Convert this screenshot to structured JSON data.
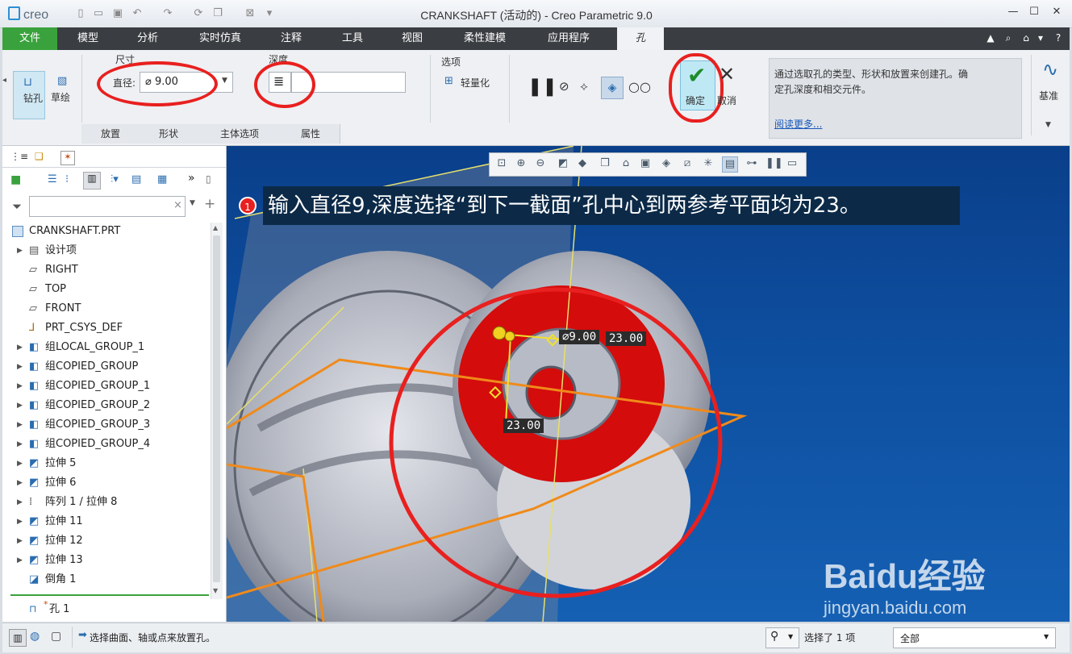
{
  "app": {
    "logo": "creo",
    "window_title": "CRANKSHAFT (活动的) - Creo Parametric 9.0"
  },
  "menu_tabs": [
    "文件",
    "模型",
    "分析",
    "实时仿真",
    "注释",
    "工具",
    "视图",
    "柔性建模",
    "应用程序",
    "孔"
  ],
  "ribbon": {
    "type_buttons": {
      "drill": "钻孔",
      "sketch": "草绘"
    },
    "size": {
      "group_label": "尺寸",
      "diameter_label": "直径:",
      "diameter_value": "⌀ 9.00"
    },
    "depth": {
      "group_label": "深度"
    },
    "options": {
      "group_label": "选项",
      "lightweight": "轻量化"
    },
    "ok": "确定",
    "cancel": "取消",
    "help": {
      "text": "通过选取孔的类型、形状和放置来创建孔。确定孔深度和相交元件。",
      "link": "阅读更多..."
    },
    "datum": "基准",
    "section_tabs": [
      "放置",
      "形状",
      "主体选项",
      "属性"
    ]
  },
  "model_tree": {
    "root": "CRANKSHAFT.PRT",
    "items": [
      {
        "label": "设计项",
        "icon": "design-items-icon",
        "expandable": true
      },
      {
        "label": "RIGHT",
        "icon": "datum-plane-icon",
        "expandable": false
      },
      {
        "label": "TOP",
        "icon": "datum-plane-icon",
        "expandable": false
      },
      {
        "label": "FRONT",
        "icon": "datum-plane-icon",
        "expandable": false
      },
      {
        "label": "PRT_CSYS_DEF",
        "icon": "csys-icon",
        "expandable": false
      },
      {
        "label": "组LOCAL_GROUP_1",
        "icon": "group-icon",
        "expandable": true
      },
      {
        "label": "组COPIED_GROUP",
        "icon": "group-icon",
        "expandable": true
      },
      {
        "label": "组COPIED_GROUP_1",
        "icon": "group-icon",
        "expandable": true
      },
      {
        "label": "组COPIED_GROUP_2",
        "icon": "group-icon",
        "expandable": true
      },
      {
        "label": "组COPIED_GROUP_3",
        "icon": "group-icon",
        "expandable": true
      },
      {
        "label": "组COPIED_GROUP_4",
        "icon": "group-icon",
        "expandable": true
      },
      {
        "label": "拉伸 5",
        "icon": "extrude-icon",
        "expandable": true
      },
      {
        "label": "拉伸 6",
        "icon": "extrude-icon",
        "expandable": true
      },
      {
        "label": "阵列 1 / 拉伸 8",
        "icon": "pattern-icon",
        "expandable": true
      },
      {
        "label": "拉伸 11",
        "icon": "extrude-icon",
        "expandable": true
      },
      {
        "label": "拉伸 12",
        "icon": "extrude-icon",
        "expandable": true
      },
      {
        "label": "拉伸 13",
        "icon": "extrude-icon",
        "expandable": true
      },
      {
        "label": "倒角 1",
        "icon": "chamfer-icon",
        "expandable": false
      }
    ],
    "active_feature": "孔 1"
  },
  "viewport": {
    "step_number": "1",
    "instruction": "输入直径9,深度选择“到下一截面”孔中心到两参考平面均为23。",
    "dim_diameter": "⌀9.00",
    "dim_offset_1": "23.00",
    "dim_offset_2": "23.00",
    "watermark_brand": "Baidu经验",
    "watermark_url": "jingyan.baidu.com"
  },
  "status": {
    "message": "选择曲面、轴或点来放置孔。",
    "selected": "选择了 1 项",
    "filter": "全部"
  },
  "colors": {
    "accent_green": "#3aa23c",
    "highlight_red": "#e8201f",
    "viewport_blue": "#0e4fa0"
  }
}
